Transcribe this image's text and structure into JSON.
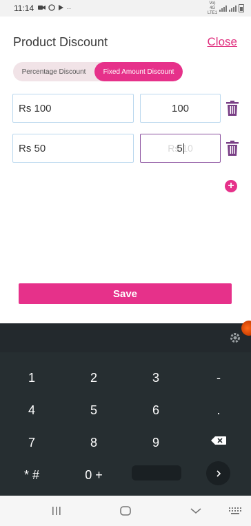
{
  "status_bar": {
    "time": "11:14",
    "network": "Vo) 4G LTE1"
  },
  "header": {
    "title": "Product Discount",
    "close_label": "Close"
  },
  "segment": {
    "options": [
      "Percentage Discount",
      "Fixed Amount Discount"
    ],
    "selected": "Fixed Amount Discount"
  },
  "rows": [
    {
      "label_value": "Rs 100",
      "amount_value": "100",
      "amount_placeholder": ""
    },
    {
      "label_value": "Rs 50",
      "amount_value": "5",
      "amount_placeholder": "Rs 10"
    }
  ],
  "save_label": "Save",
  "keyboard": {
    "keys": [
      "1",
      "2",
      "3",
      "-",
      "4",
      "5",
      "6",
      ".",
      "7",
      "8",
      "9",
      "backspace",
      "* #",
      "0 +",
      "space",
      "enter"
    ]
  },
  "colors": {
    "accent": "#e6318a",
    "trash": "#7a3f86",
    "field_border": "#b9d7ee",
    "keyboard_bg": "#262e31"
  },
  "icons": [
    "gear-icon",
    "trash-icon",
    "add-circle-icon",
    "backspace-icon",
    "chevron-right-icon",
    "recents-icon",
    "home-icon",
    "back-icon",
    "keyboard-icon"
  ]
}
